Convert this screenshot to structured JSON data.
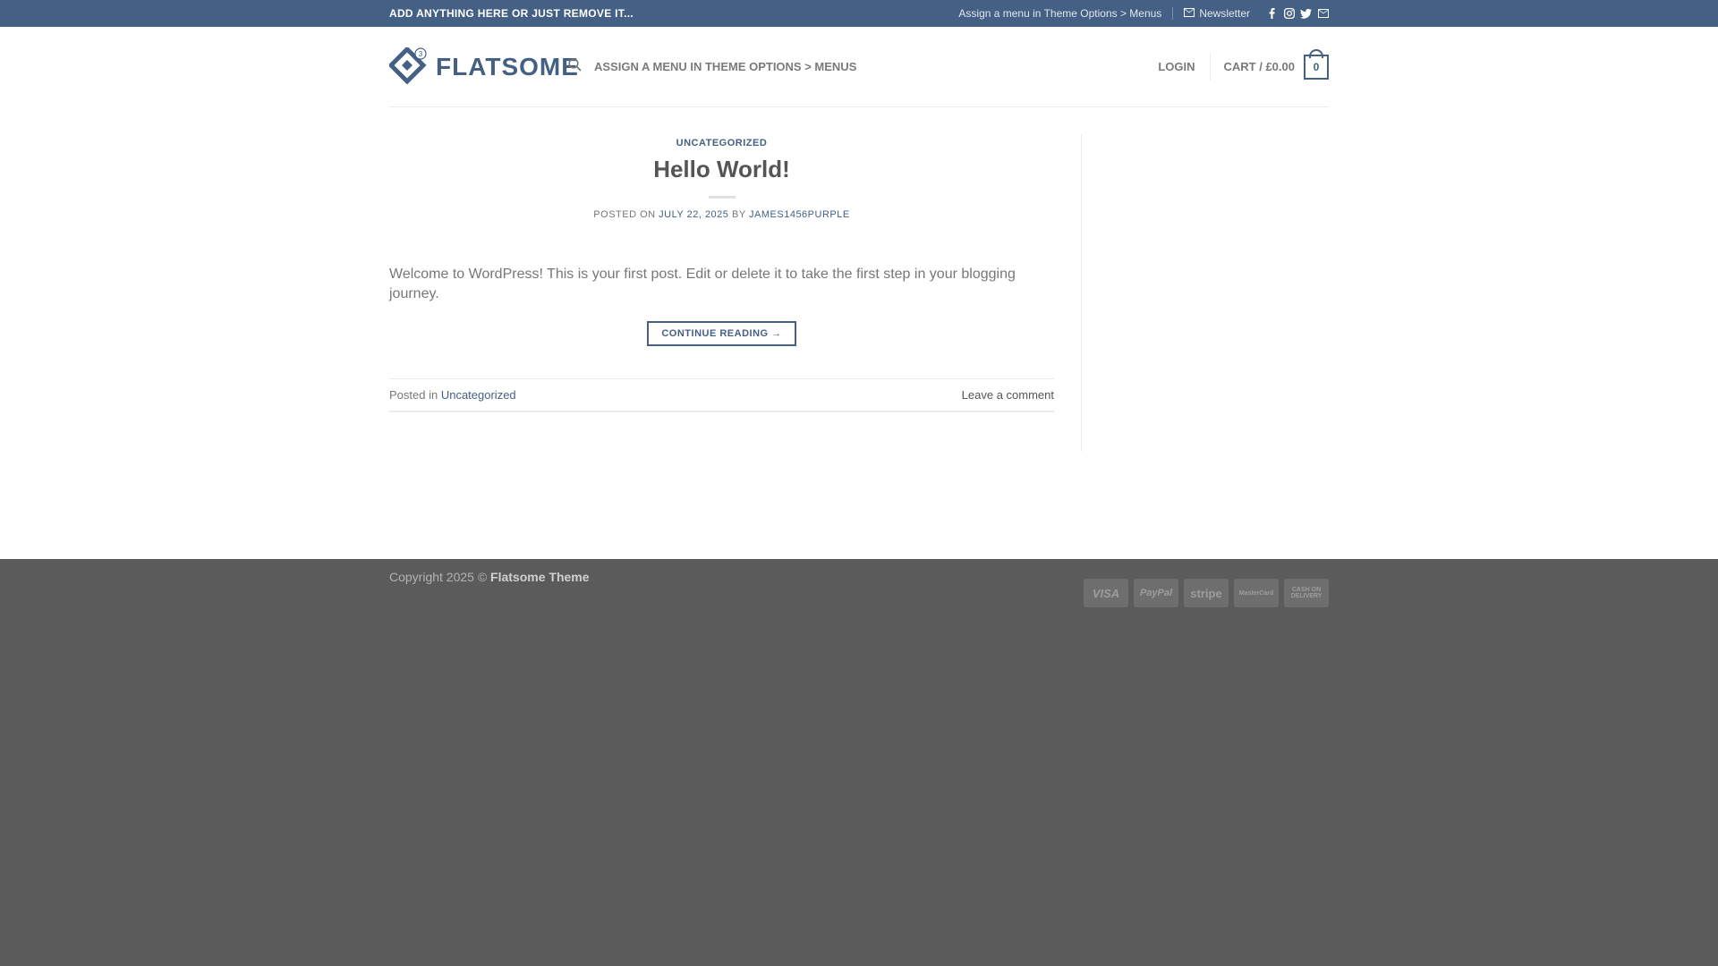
{
  "topbar": {
    "left_text": "ADD ANYTHING HERE OR JUST REMOVE IT...",
    "menu_link": "Assign a menu in Theme Options > Menus",
    "newsletter": "Newsletter",
    "social": [
      "facebook-icon",
      "instagram-icon",
      "twitter-icon",
      "email-icon"
    ]
  },
  "header": {
    "logo_text": "FLATSOME",
    "logo_badge": "3",
    "nav_menu": "ASSIGN A MENU IN THEME OPTIONS > MENUS",
    "login": "LOGIN",
    "cart_label": "CART / £0.00",
    "cart_count": "0"
  },
  "post": {
    "category": "UNCATEGORIZED",
    "title": "Hello World!",
    "posted_on_label": "POSTED ON",
    "date": "JULY 22, 2025",
    "by_label": "BY",
    "author": "JAMES1456PURPLE",
    "excerpt": "Welcome to WordPress! This is your first post. Edit or delete it to take the first step in your blogging journey.",
    "continue_label": "CONTINUE READING →",
    "posted_in_label": "Posted in",
    "posted_in_category": "Uncategorized",
    "leave_comment": "Leave a comment"
  },
  "footer": {
    "copyright_prefix": "Copyright 2025 ©",
    "copyright_brand": "Flatsome Theme",
    "payments": [
      "VISA",
      "PayPal",
      "stripe",
      "MasterCard",
      "CASH ON DELIVERY"
    ]
  },
  "colors": {
    "primary": "#446084",
    "footer_bg": "#5b5b5b"
  }
}
